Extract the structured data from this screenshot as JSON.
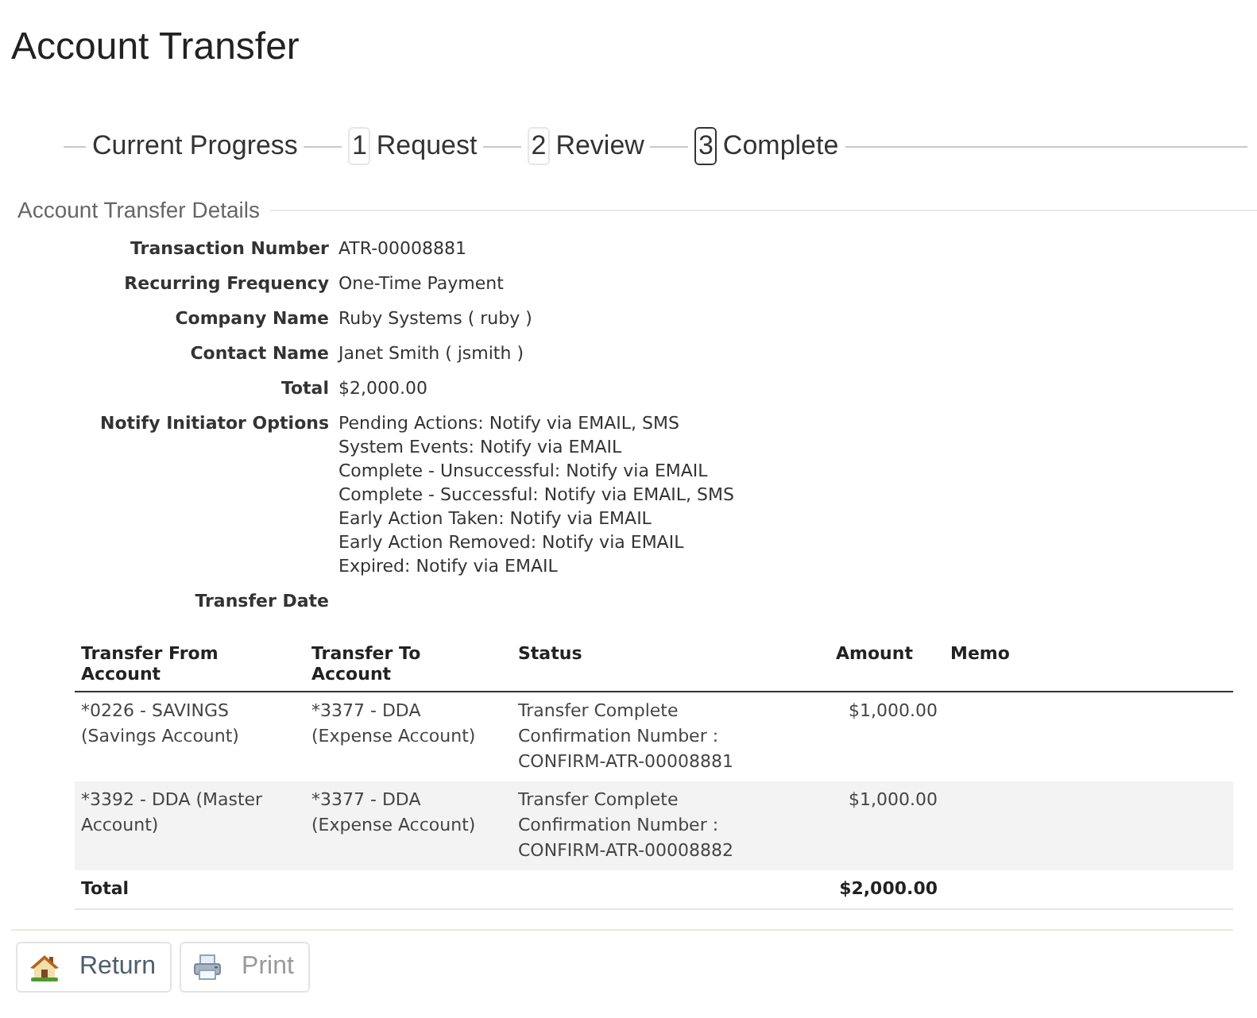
{
  "page": {
    "title": "Account Transfer"
  },
  "progress": {
    "label": "Current Progress",
    "steps": [
      {
        "number": "1",
        "label": "Request",
        "selected": false
      },
      {
        "number": "2",
        "label": "Review",
        "selected": false
      },
      {
        "number": "3",
        "label": "Complete",
        "selected": true
      }
    ]
  },
  "details": {
    "legend": "Account Transfer Details",
    "fields": [
      {
        "label": "Transaction Number",
        "value": "ATR-00008881"
      },
      {
        "label": "Recurring Frequency",
        "value": "One-Time Payment"
      },
      {
        "label": "Company Name",
        "value": "Ruby Systems ( ruby )"
      },
      {
        "label": "Contact Name",
        "value": "Janet Smith ( jsmith )"
      },
      {
        "label": "Total",
        "value": "$2,000.00"
      },
      {
        "label": "Notify Initiator Options",
        "lines": [
          "Pending Actions: Notify via EMAIL, SMS",
          "System Events: Notify via EMAIL",
          "Complete - Unsuccessful: Notify via EMAIL",
          "Complete - Successful: Notify via EMAIL, SMS",
          "Early Action Taken: Notify via EMAIL",
          "Early Action Removed: Notify via EMAIL",
          "Expired: Notify via EMAIL"
        ]
      },
      {
        "label": "Transfer Date"
      }
    ]
  },
  "table": {
    "columns": [
      "Transfer From Account",
      "Transfer To Account",
      "Status",
      "Amount",
      "Memo"
    ],
    "rows": [
      {
        "from": "*0226 - SAVINGS (Savings Account)",
        "to": "*3377 - DDA (Expense Account)",
        "status": [
          "Transfer Complete",
          "Confirmation Number :",
          "CONFIRM-ATR-00008881"
        ],
        "amount": "$1,000.00"
      },
      {
        "from": "*3392 - DDA (Master Account)",
        "to": "*3377 - DDA (Expense Account)",
        "status": [
          "Transfer Complete",
          "Confirmation Number :",
          "CONFIRM-ATR-00008882"
        ],
        "amount": "$1,000.00"
      }
    ],
    "total": {
      "label": "Total",
      "amount": "$2,000.00"
    }
  },
  "buttons": [
    {
      "kind": "home",
      "label": "Return",
      "disabled": false
    },
    {
      "kind": "print",
      "label": "Print",
      "disabled": true
    }
  ]
}
